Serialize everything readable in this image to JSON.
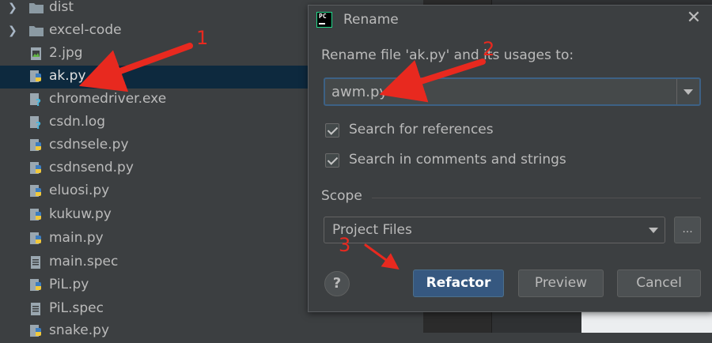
{
  "tree": {
    "items": [
      {
        "label": "dist",
        "type": "folder",
        "expandable": true
      },
      {
        "label": "excel-code",
        "type": "folder",
        "expandable": true
      },
      {
        "label": "2.jpg",
        "type": "image"
      },
      {
        "label": "ak.py",
        "type": "python",
        "selected": true
      },
      {
        "label": "chromedriver.exe",
        "type": "unknown"
      },
      {
        "label": "csdn.log",
        "type": "unknown"
      },
      {
        "label": "csdnsele.py",
        "type": "python"
      },
      {
        "label": "csdnsend.py",
        "type": "python"
      },
      {
        "label": "eluosi.py",
        "type": "python"
      },
      {
        "label": "kukuw.py",
        "type": "python"
      },
      {
        "label": "main.py",
        "type": "python"
      },
      {
        "label": "main.spec",
        "type": "text"
      },
      {
        "label": "PiL.py",
        "type": "python"
      },
      {
        "label": "PiL.spec",
        "type": "text"
      },
      {
        "label": "snake.py",
        "type": "python"
      }
    ]
  },
  "dialog": {
    "app_icon": "PC",
    "title": "Rename",
    "prompt": "Rename file 'ak.py' and its usages to:",
    "new_name": "awm.py",
    "options": [
      {
        "label": "Search for references",
        "checked": true
      },
      {
        "label": "Search in comments and strings",
        "checked": true
      }
    ],
    "scope_label": "Scope",
    "scope_value": "Project Files",
    "more_label": "...",
    "help_label": "?",
    "buttons": {
      "refactor": "Refactor",
      "preview": "Preview",
      "cancel": "Cancel"
    }
  },
  "annotations": [
    "1",
    "2",
    "3"
  ],
  "colors": {
    "selection": "#0d293e",
    "primary_button": "#365880",
    "annotation": "#e8291f"
  }
}
